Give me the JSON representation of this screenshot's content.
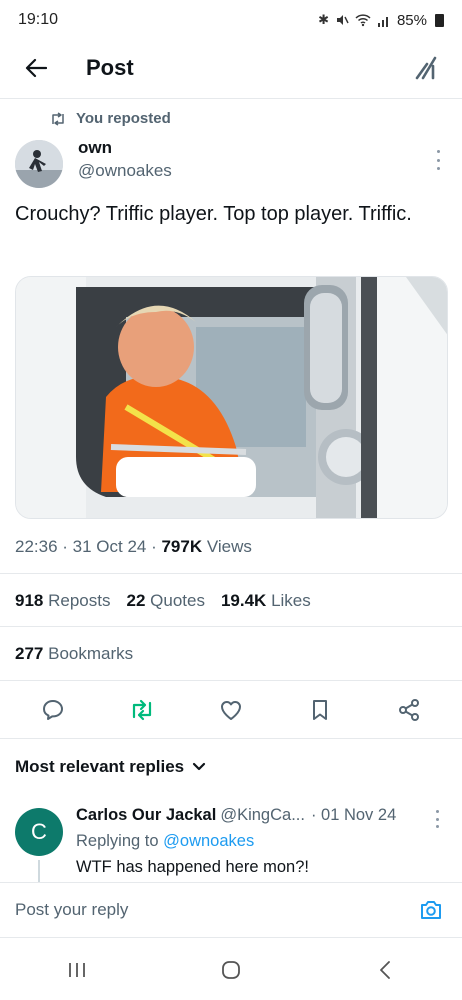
{
  "status_bar": {
    "time": "19:10",
    "battery": "85%",
    "icons": [
      "bluetooth-icon",
      "mute-icon",
      "wifi-icon",
      "signal-icon",
      "battery-icon"
    ]
  },
  "header": {
    "title": "Post",
    "back_icon": "arrow-left-icon",
    "grok_icon": "grok-icon"
  },
  "post": {
    "repost_label": "You reposted",
    "author_name": "own",
    "author_handle": "@ownoakes",
    "text": "Crouchy? Triffic player. Top top player. Triffic.",
    "timestamp": "22:36 · 31 Oct 24 · ",
    "views_count": "797K",
    "views_label": " Views",
    "stats": {
      "reposts_count": "918",
      "reposts_label": "Reposts",
      "quotes_count": "22",
      "quotes_label": "Quotes",
      "likes_count": "19.4K",
      "likes_label": "Likes",
      "bookmarks_count": "277",
      "bookmarks_label": "Bookmarks"
    },
    "actions": [
      "reply-icon",
      "repost-icon",
      "like-icon",
      "bookmark-icon",
      "share-icon"
    ]
  },
  "replies": {
    "sort_label": "Most relevant replies",
    "items": [
      {
        "avatar_letter": "C",
        "name": "Carlos Our Jackal",
        "handle": "@KingCa...",
        "date": "· 01 Nov 24",
        "replying_prefix": "Replying to ",
        "replying_to": "@ownoakes",
        "text": "WTF has happened here mon?!"
      }
    ]
  },
  "composer": {
    "placeholder": "Post your reply"
  },
  "colors": {
    "accent": "#1d9bf0",
    "repost_active": "#00ba7c",
    "secondary_text": "#536471",
    "reply_avatar": "#0d7a6b"
  }
}
